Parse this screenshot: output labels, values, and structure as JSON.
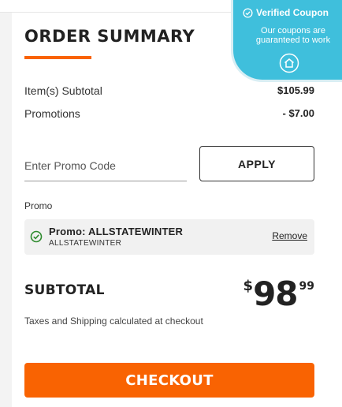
{
  "summary": {
    "title": "ORDER SUMMARY",
    "items_subtotal_label": "Item(s) Subtotal",
    "items_subtotal_value": "$105.99",
    "promotions_label": "Promotions",
    "promotions_value": "- $7.00"
  },
  "promo_entry": {
    "placeholder": "Enter Promo Code",
    "apply_label": "APPLY"
  },
  "applied_promo": {
    "section_label": "Promo",
    "name": "Promo: ALLSTATEWINTER",
    "code": "ALLSTATEWINTER",
    "remove_label": "Remove"
  },
  "subtotal": {
    "label": "SUBTOTAL",
    "currency": "$",
    "dollars": "98",
    "cents": "99",
    "note": "Taxes and Shipping calculated at checkout"
  },
  "checkout": {
    "label": "CHECKOUT"
  },
  "coupon_badge": {
    "title": "Verified Coupon",
    "subtitle": "Our coupons are guaranteed to work"
  },
  "icons": {
    "check": "check-circle-icon",
    "verified": "verified-check-icon",
    "house": "house-icon"
  },
  "colors": {
    "accent": "#f96302",
    "badge": "#3fbfdc",
    "check_green": "#2e8b2e"
  }
}
